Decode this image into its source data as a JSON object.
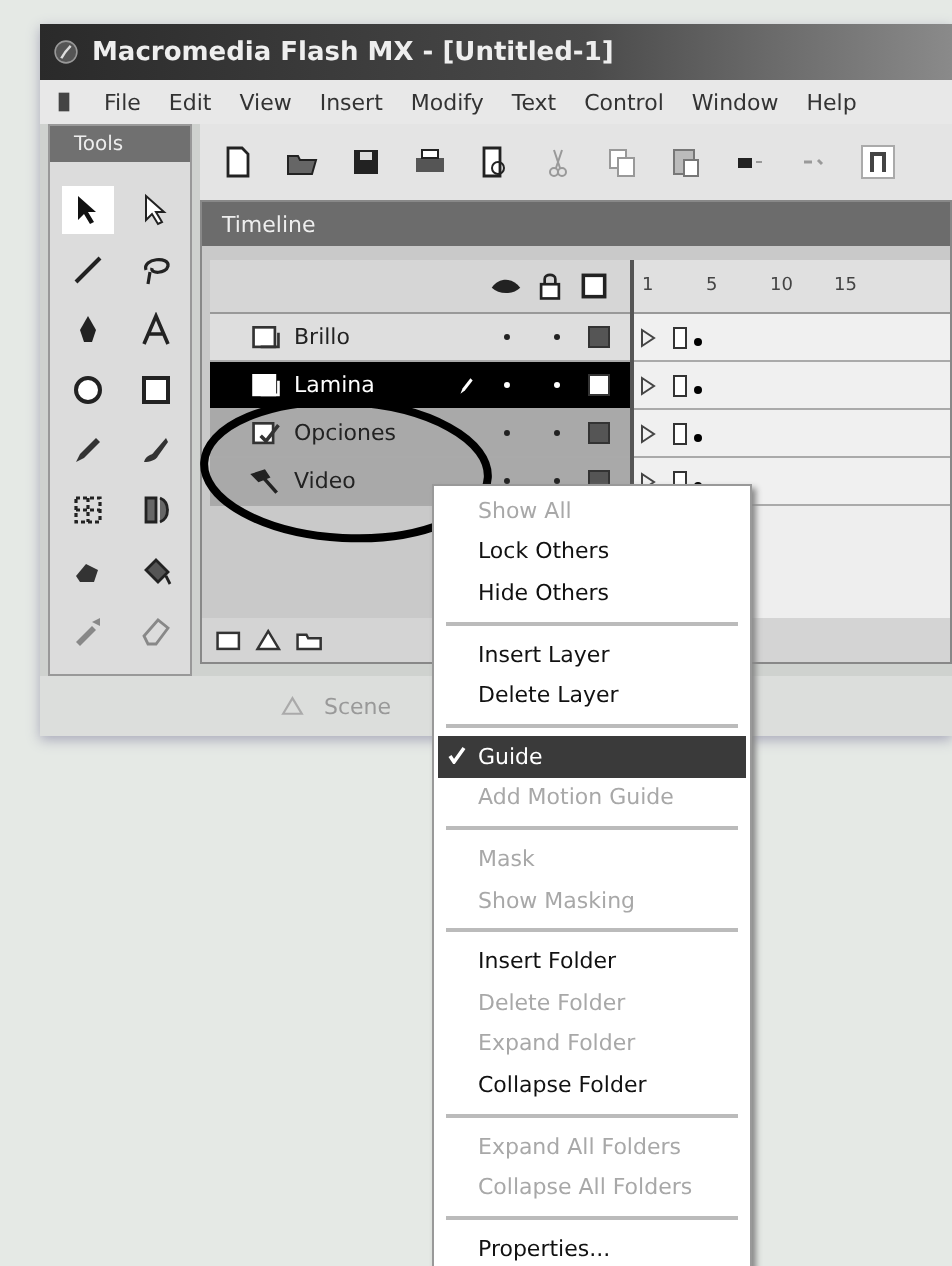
{
  "window": {
    "title": "Macromedia Flash MX - [Untitled-1]"
  },
  "menu_bar": [
    "File",
    "Edit",
    "View",
    "Insert",
    "Modify",
    "Text",
    "Control",
    "Window",
    "Help"
  ],
  "tools_panel": {
    "title": "Tools",
    "tools": [
      {
        "kind": "arrow",
        "selected": true
      },
      {
        "kind": "subselect",
        "selected": false
      },
      {
        "kind": "line",
        "selected": false
      },
      {
        "kind": "lasso",
        "selected": false
      },
      {
        "kind": "pen",
        "selected": false
      },
      {
        "kind": "text",
        "selected": false
      },
      {
        "kind": "oval",
        "selected": false
      },
      {
        "kind": "rect",
        "selected": false
      },
      {
        "kind": "pencil",
        "selected": false
      },
      {
        "kind": "brush",
        "selected": false
      },
      {
        "kind": "transform",
        "selected": false
      },
      {
        "kind": "fill-transform",
        "selected": false
      },
      {
        "kind": "ink",
        "selected": false
      },
      {
        "kind": "bucket",
        "selected": false
      },
      {
        "kind": "dropper",
        "selected": false
      },
      {
        "kind": "eraser",
        "selected": false
      }
    ]
  },
  "timeline": {
    "title": "Timeline",
    "ruler": [
      "1",
      "5",
      "10",
      "15"
    ],
    "layers": [
      {
        "name": "Brillo",
        "kind": "layer",
        "selected": false,
        "highlighted": false
      },
      {
        "name": "Lamina",
        "kind": "layer",
        "selected": true,
        "highlighted": false
      },
      {
        "name": "Opciones",
        "kind": "guided",
        "selected": false,
        "highlighted": true
      },
      {
        "name": "Video",
        "kind": "guide",
        "selected": false,
        "highlighted": true
      }
    ]
  },
  "status_bar": {
    "scene": "Scene"
  },
  "context_menu": {
    "items": [
      {
        "kind": "item",
        "label": "Show All",
        "enabled": false,
        "checked": false,
        "selected": false
      },
      {
        "kind": "item",
        "label": "Lock Others",
        "enabled": true,
        "checked": false,
        "selected": false
      },
      {
        "kind": "item",
        "label": "Hide Others",
        "enabled": true,
        "checked": false,
        "selected": false
      },
      {
        "kind": "separator"
      },
      {
        "kind": "item",
        "label": "Insert Layer",
        "enabled": true,
        "checked": false,
        "selected": false
      },
      {
        "kind": "item",
        "label": "Delete Layer",
        "enabled": true,
        "checked": false,
        "selected": false
      },
      {
        "kind": "separator"
      },
      {
        "kind": "item",
        "label": "Guide",
        "enabled": true,
        "checked": true,
        "selected": true
      },
      {
        "kind": "item",
        "label": "Add Motion Guide",
        "enabled": false,
        "checked": false,
        "selected": false
      },
      {
        "kind": "separator"
      },
      {
        "kind": "item",
        "label": "Mask",
        "enabled": false,
        "checked": false,
        "selected": false
      },
      {
        "kind": "item",
        "label": "Show Masking",
        "enabled": false,
        "checked": false,
        "selected": false
      },
      {
        "kind": "separator"
      },
      {
        "kind": "item",
        "label": "Insert Folder",
        "enabled": true,
        "checked": false,
        "selected": false
      },
      {
        "kind": "item",
        "label": "Delete Folder",
        "enabled": false,
        "checked": false,
        "selected": false
      },
      {
        "kind": "item",
        "label": "Expand Folder",
        "enabled": false,
        "checked": false,
        "selected": false
      },
      {
        "kind": "item",
        "label": "Collapse Folder",
        "enabled": true,
        "checked": false,
        "selected": false
      },
      {
        "kind": "separator"
      },
      {
        "kind": "item",
        "label": "Expand All Folders",
        "enabled": false,
        "checked": false,
        "selected": false
      },
      {
        "kind": "item",
        "label": "Collapse All Folders",
        "enabled": false,
        "checked": false,
        "selected": false
      },
      {
        "kind": "separator"
      },
      {
        "kind": "item",
        "label": "Properties...",
        "enabled": true,
        "checked": false,
        "selected": false
      }
    ]
  }
}
